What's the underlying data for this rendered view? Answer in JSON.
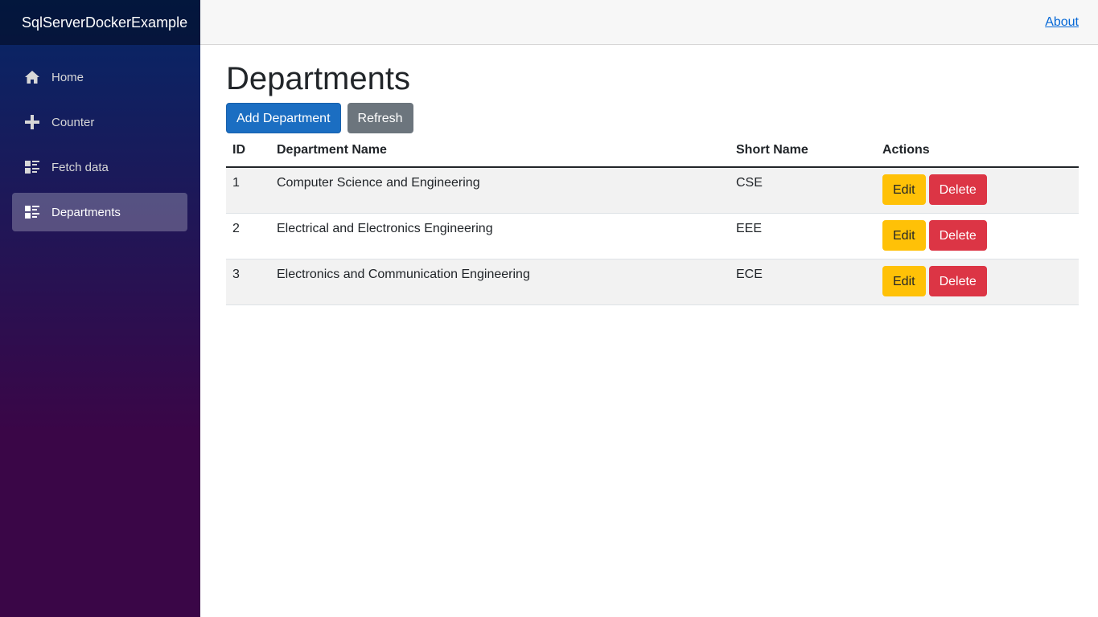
{
  "app": {
    "brand": "SqlServerDockerExample"
  },
  "sidebar": {
    "items": [
      {
        "label": "Home",
        "icon": "home-icon",
        "active": false
      },
      {
        "label": "Counter",
        "icon": "plus-icon",
        "active": false
      },
      {
        "label": "Fetch data",
        "icon": "list-rich-icon",
        "active": false
      },
      {
        "label": "Departments",
        "icon": "list-rich-icon",
        "active": true
      }
    ]
  },
  "topbar": {
    "about_label": "About"
  },
  "page": {
    "title": "Departments",
    "add_button": "Add Department",
    "refresh_button": "Refresh"
  },
  "table": {
    "headers": [
      "ID",
      "Department Name",
      "Short Name",
      "Actions"
    ],
    "rows": [
      {
        "id": "1",
        "name": "Computer Science and Engineering",
        "short": "CSE"
      },
      {
        "id": "2",
        "name": "Electrical and Electronics Engineering",
        "short": "EEE"
      },
      {
        "id": "3",
        "name": "Electronics and Communication Engineering",
        "short": "ECE"
      }
    ],
    "edit_label": "Edit",
    "delete_label": "Delete"
  },
  "colors": {
    "primary": "#1b6ec2",
    "secondary": "#6c757d",
    "warning": "#ffc107",
    "danger": "#dc3545",
    "sidebar_top": "#052767",
    "sidebar_bottom": "#3a0647",
    "link": "#0366d6"
  }
}
